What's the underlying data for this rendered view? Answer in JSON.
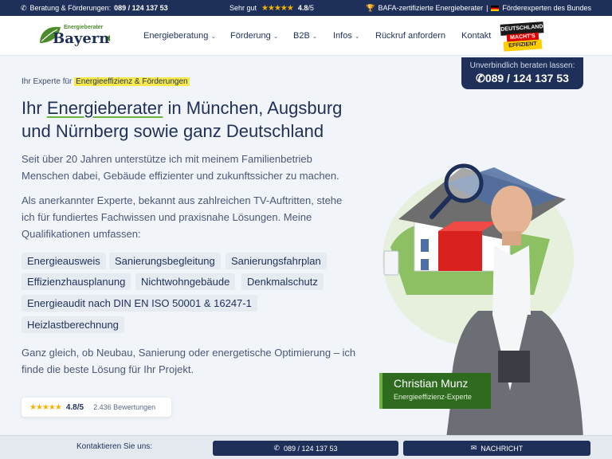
{
  "topbar": {
    "consult_label": "Beratung & Förderungen:",
    "consult_phone": "089 / 124 137 53",
    "rating_label": "Sehr gut",
    "rating_value": "4.8",
    "rating_max": "/5",
    "bafa_text": "BAFA-zertifizierte Energieberater",
    "separator": "|",
    "experts_text": "Förderexperten des Bundes"
  },
  "header": {
    "logo_small": "Energieberater",
    "logo_big": "Bayern",
    "nav": [
      {
        "label": "Energieberatung"
      },
      {
        "label": "Förderung"
      },
      {
        "label": "B2B"
      },
      {
        "label": "Infos"
      },
      {
        "label": "Rückruf anfordern"
      },
      {
        "label": "Kontakt"
      }
    ],
    "badge_line1": "DEUTSCHLAND",
    "badge_line2": "MACHT'S",
    "badge_line3": "EFFIZIENT"
  },
  "callbox": {
    "label": "Unverbindlich beraten lassen:",
    "phone": "089 / 124 137 53"
  },
  "hero": {
    "eyebrow_prefix": "Ihr Experte für",
    "eyebrow_highlight": "Energieeffizienz & Förderungen",
    "title_part1": "Ihr",
    "title_highlight": "Energieberater",
    "title_part2": "in München, Augsburg und Nürnberg sowie ganz Deutschland",
    "para1": "Seit über 20 Jahren unterstütze ich mit meinem Familienbetrieb Menschen dabei, Gebäude effizienter und zukunftssicher zu machen.",
    "para2": "Als anerkannter Experte, bekannt aus zahlreichen TV-Auftritten, stehe ich für fundiertes Fachwissen und praxisnahe Lösungen. Meine Qualifikationen umfassen:",
    "tags": [
      "Energieausweis",
      "Sanierungsbegleitung",
      "Sanierungsfahrplan",
      "Effizienzhausplanung",
      "Nichtwohngebäude",
      "Denkmalschutz",
      "Energieaudit nach DIN EN ISO 50001 & 16247-1",
      "Heizlastberechnung"
    ],
    "para3": "Ganz gleich, ob Neubau, Sanierung oder energetische Optimierung – ich finde die beste Lösung für Ihr Projekt.",
    "rating_value": "4.8/5",
    "rating_count": "2.436 Bewertungen"
  },
  "person": {
    "name": "Christian Munz",
    "role": "Energieeffizienz-Experte"
  },
  "bottombar": {
    "label": "Kontaktieren Sie uns:",
    "phone_label": "089 / 124 137 53",
    "message_label": "NACHRICHT"
  },
  "colors": {
    "navy": "#1e3059",
    "green": "#6cb33f",
    "highlight": "#f7e94a",
    "star": "#f5b301"
  }
}
